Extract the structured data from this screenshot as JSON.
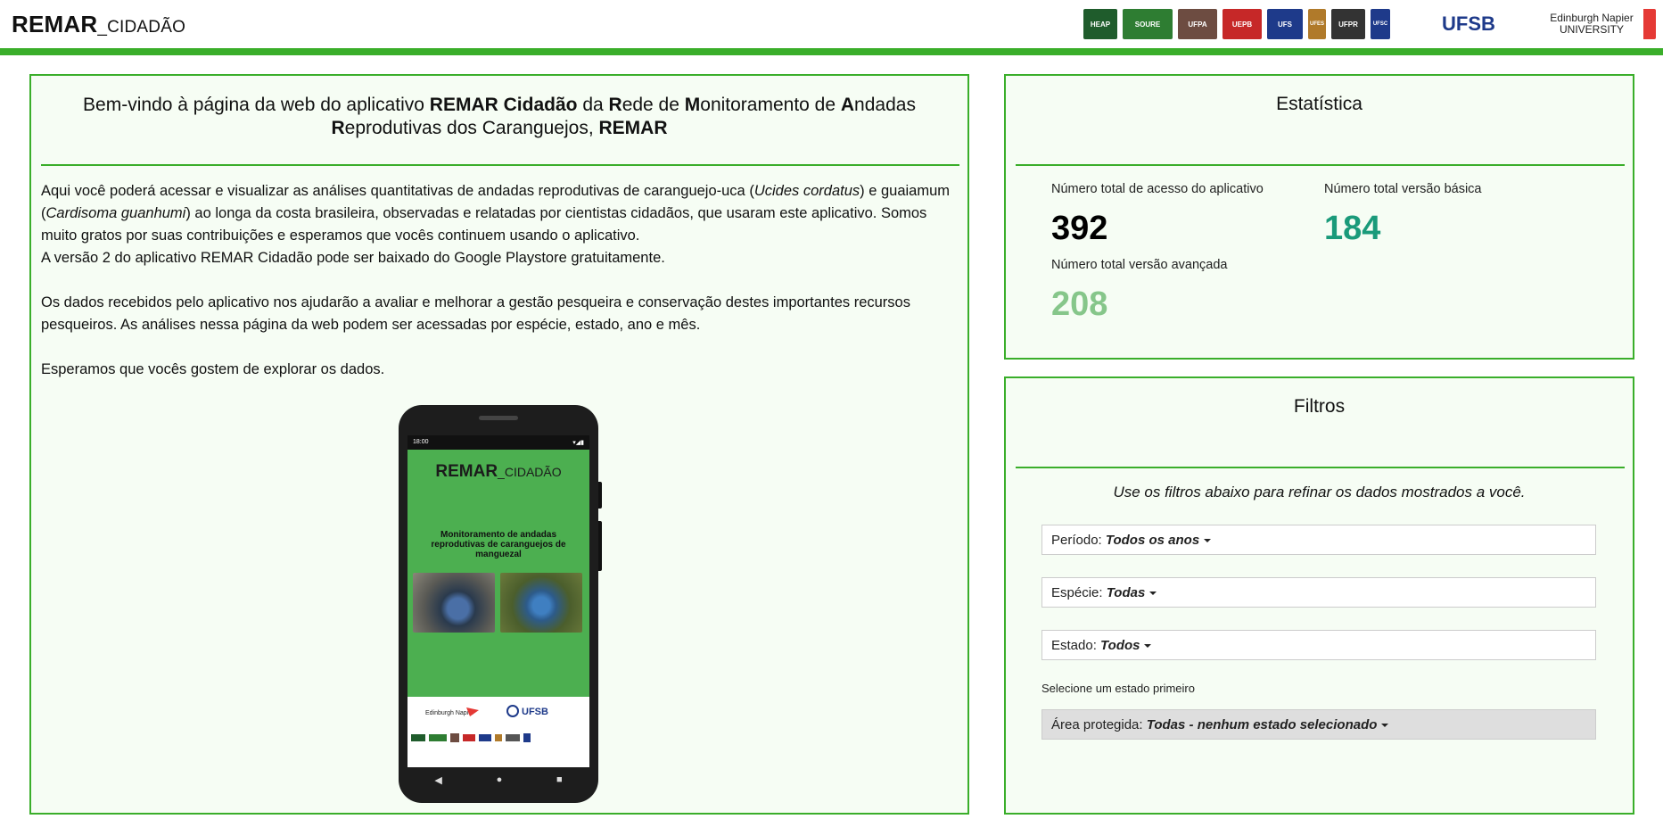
{
  "header": {
    "brand_main": "REMAR",
    "brand_sub": "_CIDADÃO",
    "logos": [
      {
        "icon": "heap-logo",
        "text": "HEAP",
        "color": "#1f5c2c"
      },
      {
        "icon": "marinha-soure-logo",
        "text": "SOURE",
        "color": "#2e7d32"
      },
      {
        "icon": "ufpa-seal-logo",
        "text": "UFPA",
        "color": "#6d4c41"
      },
      {
        "icon": "uepb-logo",
        "text": "UEPB",
        "color": "#c62828"
      },
      {
        "icon": "ufs-logo",
        "text": "UFS",
        "color": "#1e3a8a"
      },
      {
        "icon": "ufes-logo",
        "text": "UFES",
        "color": "#b07a2a"
      },
      {
        "icon": "ufpr-logo",
        "text": "UFPR",
        "color": "#333333"
      },
      {
        "icon": "ufsc-logo",
        "text": "UFSC",
        "color": "#1e3a8a"
      },
      {
        "icon": "ufsb-logo",
        "text": "UFSB",
        "color": "#1e3a8a"
      },
      {
        "icon": "edinburgh-napier-logo",
        "text": "Edinburgh Napier UNIVERSITY",
        "color": "#e53935"
      }
    ]
  },
  "welcome": {
    "p1": "Bem-vindo à página da web do aplicativo ",
    "b1": "REMAR Cidadão",
    "p2": " da ",
    "b2": "R",
    "p3": "ede de ",
    "b3": "M",
    "p4": "onitoramento de ",
    "b4": "A",
    "p5": "ndadas ",
    "b5": "R",
    "p6": "eprodutivas dos Caranguejos, ",
    "b6": "REMAR"
  },
  "intro": {
    "l1a": "Aqui você poderá acessar e visualizar as análises quantitativas de andadas reprodutivas de caranguejo-uca (",
    "l1i": "Ucides cordatus",
    "l1b": ") e guaiamum (",
    "l1i2": "Cardisoma guanhumi",
    "l1c": ") ao longa da costa brasileira, observadas e relatadas por cientistas cidadãos, que usaram este aplicativo. Somos muito gratos por suas contribuições e esperamos que vocês continuem usando o aplicativo.",
    "l2": "A versão 2 do aplicativo REMAR Cidadão pode ser baixado do Google Playstore gratuitamente.",
    "l3": "Os dados recebidos pelo aplicativo nos ajudarão a avaliar e melhorar a gestão pesqueira e conservação destes importantes recursos pesqueiros. As análises nessa página da web podem ser acessadas por espécie, estado, ano e mês.",
    "l4": "Esperamos que vocês gostem de explorar os dados."
  },
  "phone": {
    "time": "18:00",
    "status_icons": "▾◢▮",
    "app_title_main": "REMAR",
    "app_title_sub": "_CIDADÃO",
    "app_subtitle": "Monitoramento de andadas reprodutivas de caranguejos de manguezal",
    "logo_napier": "Edinburgh Napier",
    "logo_ufsb": "UFSB",
    "nav_back": "◀",
    "nav_home": "●",
    "nav_recent": "■"
  },
  "stats": {
    "title": "Estatística",
    "total_label": "Número total de acesso do aplicativo",
    "total_value": "392",
    "basic_label": "Número total versão básica",
    "basic_value": "184",
    "advanced_label": "Número total versão avançada",
    "advanced_value": "208",
    "colors": {
      "total": "#000000",
      "basic": "#1a9a7a",
      "advanced": "#86c68a"
    }
  },
  "filters": {
    "title": "Filtros",
    "note": "Use os filtros abaixo para refinar os dados mostrados a você.",
    "period_label": "Período: ",
    "period_value": "Todos os anos",
    "species_label": "Espécie: ",
    "species_value": "Todas",
    "state_label": "Estado: ",
    "state_value": "Todos",
    "hint": "Selecione um estado primeiro",
    "area_label": "Área protegida: ",
    "area_value": "Todas - nenhum estado selecionado"
  }
}
